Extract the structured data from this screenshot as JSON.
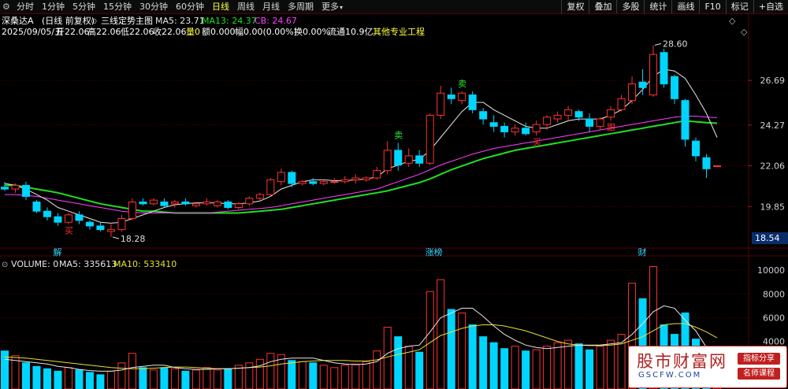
{
  "toolbar": {
    "periods": [
      "分时",
      "1分钟",
      "5分钟",
      "15分钟",
      "30分钟",
      "60分钟",
      "日线",
      "周线",
      "月线",
      "多周期",
      "更多"
    ],
    "active_period": "日线",
    "right_buttons": [
      "复权",
      "叠加",
      "多股",
      "统计",
      "画线",
      "F10",
      "标记",
      "+自选"
    ]
  },
  "header": {
    "stock": "深桑达A",
    "mode": "(日线 前复权)",
    "indicator_name": "三线定势主图",
    "ma5": "MA5: 23.71",
    "ma13": "MA13: 24.37",
    "cb": "CB: 24.67"
  },
  "info": {
    "date": "2025/09/05/五",
    "open": "开22.06",
    "high": "高22.06",
    "low": "低22.06",
    "close": "收22.06",
    "vol": "量0",
    "amount": "额0.000",
    "change": "幅0.00(0.00%)",
    "turnover": "换0.00%",
    "float": "流通10.9亿",
    "sector": "其他专业工程"
  },
  "markers": {
    "high_label": "28.60",
    "low_label": "18.28",
    "current_price": "18.54",
    "bottom_labels": [
      {
        "text": "解",
        "index": 5
      },
      {
        "text": "涨榜",
        "index": 40
      },
      {
        "text": "财",
        "index": 60
      }
    ],
    "signals": [
      {
        "text": "卖",
        "index": 37,
        "color": "#30e030"
      },
      {
        "text": "卖",
        "index": 43,
        "color": "#30e030"
      },
      {
        "text": "买",
        "index": 6,
        "color": "#ff3030"
      },
      {
        "text": "买",
        "index": 50,
        "color": "#ff3030"
      },
      {
        "text": "跟",
        "index": 57,
        "color": "#ff3030"
      }
    ]
  },
  "volume_header": {
    "label": "VOLUME: 0",
    "ma5": "MA5: 335613",
    "ma10": "MA10: 533410"
  },
  "colors": {
    "up": "#ff3232",
    "down": "#00d5ff",
    "ma5": "#e8e8e8",
    "ma13": "#ff40ff",
    "cb": "#20e020",
    "vol_ma10": "#e8e030",
    "grid": "#5a0000"
  },
  "watermark": {
    "title": "股市财富网",
    "url": "GSCFW.COM",
    "tag1": "指标分享",
    "tag2": "名师课程"
  },
  "chart_data": {
    "type": "candlestick",
    "y_ticks": [
      19.85,
      22.06,
      24.27,
      26.69
    ],
    "ylim": [
      17.9,
      29.0
    ],
    "vol_ticks": [
      4000,
      6000,
      8000,
      10000
    ],
    "vol_ylim": [
      0,
      11000
    ],
    "ohlc": [
      [
        20.9,
        21.2,
        20.7,
        20.8
      ],
      [
        20.8,
        21.1,
        20.6,
        21.0
      ],
      [
        21.0,
        21.2,
        20.2,
        20.4
      ],
      [
        20.1,
        20.2,
        19.5,
        19.6
      ],
      [
        19.6,
        19.8,
        19.1,
        19.3
      ],
      [
        19.3,
        19.5,
        18.8,
        19.0
      ],
      [
        19.0,
        19.5,
        18.9,
        19.4
      ],
      [
        19.4,
        19.6,
        18.9,
        19.1
      ],
      [
        19.0,
        19.1,
        18.6,
        18.8
      ],
      [
        18.8,
        19.0,
        18.5,
        18.6
      ],
      [
        18.5,
        18.9,
        18.2,
        18.6
      ],
      [
        18.6,
        19.4,
        18.5,
        19.2
      ],
      [
        19.2,
        20.3,
        19.1,
        20.1
      ],
      [
        20.1,
        20.3,
        19.9,
        20.0
      ],
      [
        20.0,
        20.3,
        19.9,
        20.2
      ],
      [
        20.1,
        20.3,
        19.8,
        19.9
      ],
      [
        20.0,
        20.2,
        19.8,
        20.1
      ],
      [
        20.1,
        20.3,
        19.9,
        20.0
      ],
      [
        19.9,
        20.1,
        19.8,
        20.0
      ],
      [
        20.0,
        20.3,
        19.9,
        20.1
      ],
      [
        19.9,
        20.2,
        19.8,
        20.1
      ],
      [
        20.1,
        20.2,
        19.7,
        19.8
      ],
      [
        19.8,
        20.1,
        19.7,
        20.0
      ],
      [
        20.0,
        20.4,
        19.9,
        20.3
      ],
      [
        20.3,
        20.6,
        20.2,
        20.5
      ],
      [
        20.5,
        21.4,
        20.4,
        21.3
      ],
      [
        21.2,
        21.9,
        21.0,
        21.7
      ],
      [
        21.7,
        21.8,
        20.9,
        21.1
      ],
      [
        21.1,
        21.3,
        21.0,
        21.2
      ],
      [
        21.2,
        21.4,
        21.0,
        21.1
      ],
      [
        21.1,
        21.3,
        21.0,
        21.2
      ],
      [
        21.2,
        21.4,
        21.1,
        21.2
      ],
      [
        21.2,
        21.5,
        21.1,
        21.3
      ],
      [
        21.3,
        21.6,
        21.1,
        21.4
      ],
      [
        21.3,
        21.5,
        21.2,
        21.4
      ],
      [
        21.4,
        22.0,
        21.3,
        21.8
      ],
      [
        21.8,
        23.4,
        21.6,
        22.9
      ],
      [
        22.9,
        23.3,
        21.8,
        22.1
      ],
      [
        22.2,
        23.0,
        22.0,
        22.6
      ],
      [
        22.6,
        22.9,
        22.0,
        22.2
      ],
      [
        22.2,
        24.9,
        22.1,
        24.8
      ],
      [
        24.8,
        26.4,
        24.6,
        26.0
      ],
      [
        25.9,
        26.3,
        25.4,
        25.7
      ],
      [
        25.6,
        26.1,
        25.4,
        26.0
      ],
      [
        25.9,
        26.1,
        24.9,
        25.1
      ],
      [
        25.0,
        25.2,
        24.3,
        24.6
      ],
      [
        24.4,
        24.8,
        23.9,
        24.2
      ],
      [
        24.2,
        24.4,
        23.6,
        23.9
      ],
      [
        23.9,
        24.3,
        23.7,
        24.1
      ],
      [
        24.1,
        24.4,
        23.7,
        23.8
      ],
      [
        23.9,
        24.5,
        23.7,
        24.3
      ],
      [
        24.3,
        24.8,
        24.0,
        24.7
      ],
      [
        24.6,
        25.0,
        24.4,
        24.8
      ],
      [
        24.8,
        25.3,
        24.5,
        25.1
      ],
      [
        25.0,
        25.1,
        24.5,
        24.7
      ],
      [
        24.6,
        24.9,
        23.9,
        24.2
      ],
      [
        24.2,
        24.7,
        24.0,
        24.6
      ],
      [
        24.7,
        25.3,
        24.5,
        25.1
      ],
      [
        25.1,
        25.9,
        25.0,
        25.7
      ],
      [
        25.6,
        26.9,
        25.4,
        26.5
      ],
      [
        26.6,
        27.3,
        25.9,
        26.3
      ],
      [
        25.9,
        28.6,
        25.8,
        28.1
      ],
      [
        28.2,
        28.4,
        26.3,
        26.5
      ],
      [
        26.9,
        27.0,
        25.4,
        25.7
      ],
      [
        25.6,
        25.7,
        23.1,
        23.5
      ],
      [
        23.4,
        23.6,
        22.3,
        22.6
      ],
      [
        22.5,
        22.7,
        21.4,
        21.9
      ],
      [
        22.06,
        22.06,
        22.06,
        22.06
      ]
    ],
    "volume": [
      3200,
      2800,
      2200,
      1900,
      1700,
      1500,
      1800,
      1600,
      1400,
      1200,
      1500,
      2200,
      3000,
      1800,
      1600,
      1800,
      1700,
      1500,
      1600,
      1800,
      1600,
      1700,
      2000,
      2200,
      2500,
      3000,
      2900,
      2400,
      2300,
      2200,
      2000,
      1800,
      2000,
      2100,
      2300,
      3200,
      5200,
      4400,
      3600,
      3100,
      8200,
      9200,
      6700,
      6400,
      5400,
      4400,
      3900,
      3400,
      3600,
      3200,
      3300,
      3600,
      3900,
      4100,
      3800,
      3300,
      3600,
      4100,
      4600,
      8900,
      7600,
      10300,
      5400,
      4600,
      6400,
      4200,
      3300,
      1000
    ],
    "ma5": [
      21.1,
      21.0,
      20.8,
      20.5,
      20.2,
      19.8,
      19.6,
      19.4,
      19.2,
      19.0,
      18.95,
      19.0,
      19.2,
      19.4,
      19.6,
      19.8,
      19.95,
      20.0,
      20.05,
      20.05,
      20.05,
      20.0,
      20.0,
      20.05,
      20.15,
      20.4,
      20.8,
      21.0,
      21.2,
      21.3,
      21.3,
      21.25,
      21.25,
      21.3,
      21.35,
      21.45,
      21.9,
      22.1,
      22.3,
      22.4,
      22.9,
      23.6,
      24.3,
      25.0,
      25.5,
      25.5,
      25.1,
      24.8,
      24.5,
      24.2,
      24.1,
      24.1,
      24.3,
      24.5,
      24.6,
      24.6,
      24.6,
      24.8,
      25.1,
      25.6,
      26.2,
      26.9,
      27.3,
      27.2,
      26.8,
      25.9,
      24.9,
      23.6
    ],
    "ma13": [
      20.5,
      20.5,
      20.45,
      20.4,
      20.3,
      20.2,
      20.1,
      20.0,
      19.9,
      19.8,
      19.7,
      19.6,
      19.55,
      19.5,
      19.5,
      19.5,
      19.5,
      19.5,
      19.5,
      19.5,
      19.55,
      19.6,
      19.65,
      19.7,
      19.75,
      19.8,
      19.9,
      20.0,
      20.1,
      20.2,
      20.3,
      20.4,
      20.5,
      20.6,
      20.7,
      20.8,
      21.0,
      21.2,
      21.4,
      21.6,
      21.85,
      22.1,
      22.3,
      22.5,
      22.7,
      22.85,
      23.0,
      23.1,
      23.2,
      23.3,
      23.4,
      23.5,
      23.6,
      23.7,
      23.8,
      23.9,
      24.0,
      24.1,
      24.2,
      24.3,
      24.4,
      24.5,
      24.6,
      24.7,
      24.75,
      24.75,
      24.7,
      24.67
    ],
    "cb": [
      21.0,
      21.0,
      20.9,
      20.8,
      20.7,
      20.6,
      20.45,
      20.3,
      20.15,
      20.0,
      19.9,
      19.8,
      19.7,
      19.6,
      19.6,
      19.55,
      19.5,
      19.5,
      19.5,
      19.5,
      19.5,
      19.5,
      19.5,
      19.55,
      19.6,
      19.65,
      19.7,
      19.8,
      19.9,
      20.0,
      20.1,
      20.2,
      20.3,
      20.4,
      20.5,
      20.6,
      20.7,
      20.85,
      21.0,
      21.15,
      21.35,
      21.6,
      21.85,
      22.05,
      22.25,
      22.45,
      22.6,
      22.75,
      22.9,
      23.0,
      23.1,
      23.2,
      23.3,
      23.4,
      23.5,
      23.6,
      23.7,
      23.8,
      23.9,
      24.0,
      24.1,
      24.2,
      24.3,
      24.4,
      24.5,
      24.45,
      24.4,
      24.37
    ],
    "vol_ma5": [
      2500,
      2400,
      2300,
      2200,
      2100,
      1900,
      1800,
      1650,
      1550,
      1500,
      1500,
      1600,
      1800,
      1900,
      2000,
      2000,
      1800,
      1700,
      1650,
      1650,
      1700,
      1700,
      1750,
      1800,
      1950,
      2300,
      2500,
      2600,
      2600,
      2600,
      2400,
      2200,
      2100,
      2050,
      2100,
      2300,
      3000,
      3400,
      3600,
      3700,
      4800,
      6000,
      6400,
      6800,
      6800,
      6100,
      5300,
      4600,
      4100,
      3700,
      3500,
      3400,
      3500,
      3600,
      3700,
      3700,
      3700,
      3800,
      3900,
      4600,
      5500,
      6500,
      7000,
      6800,
      5800,
      4900,
      3500,
      2200
    ],
    "vol_ma10": [
      2700,
      2650,
      2600,
      2500,
      2400,
      2300,
      2200,
      2100,
      2000,
      1900,
      1800,
      1750,
      1700,
      1700,
      1750,
      1800,
      1850,
      1850,
      1800,
      1750,
      1700,
      1700,
      1750,
      1800,
      1850,
      1950,
      2100,
      2200,
      2300,
      2350,
      2400,
      2400,
      2400,
      2350,
      2350,
      2450,
      2700,
      2900,
      3100,
      3300,
      3900,
      4500,
      4800,
      5100,
      5300,
      5400,
      5400,
      5300,
      5100,
      4900,
      4600,
      4300,
      4000,
      3800,
      3700,
      3650,
      3650,
      3700,
      3800,
      4100,
      4400,
      4900,
      5400,
      5500,
      5500,
      5200,
      4800,
      4300
    ]
  }
}
